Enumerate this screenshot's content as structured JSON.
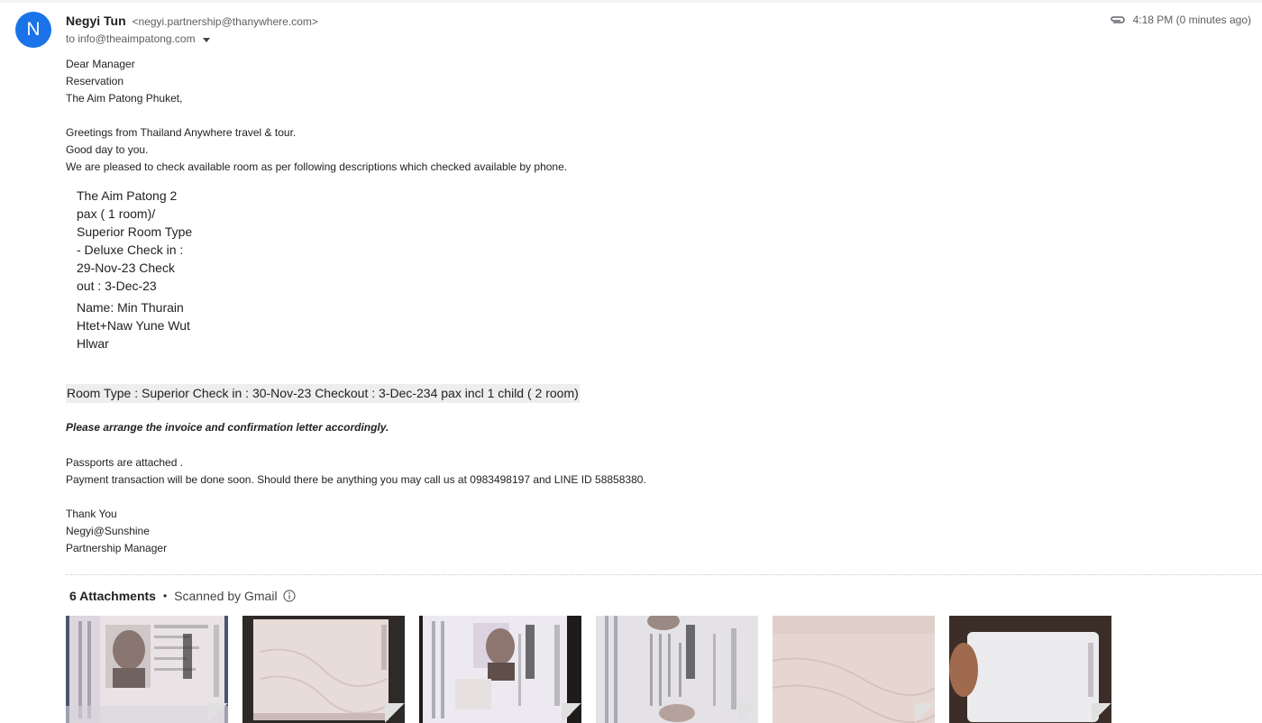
{
  "header": {
    "avatar_letter": "N",
    "sender_name": "Negyi Tun",
    "sender_email": "<negyi.partnership@thanywhere.com>",
    "recipient": "to info@theaimpatong.com",
    "time": "4:18 PM (0 minutes ago)"
  },
  "body": {
    "greeting_lines": [
      "Dear Manager",
      "Reservation",
      "The Aim Patong Phuket,"
    ],
    "intro_lines": [
      "Greetings from Thailand Anywhere travel & tour.",
      "Good day to you.",
      "We are pleased to check available room as per following descriptions which checked available by phone."
    ],
    "booking_lines": [
      "The Aim Patong 2",
      "pax ( 1 room)/",
      "Superior Room Type",
      "- Deluxe Check in :",
      "29-Nov-23 Check",
      "out : 3-Dec-23"
    ],
    "name_lines": [
      "Name: Min Thurain",
      "Htet+Naw Yune Wut",
      "Hlwar"
    ],
    "room_type_line": "Room Type : Superior Check in : 30-Nov-23 Checkout : 3-Dec-234 pax incl 1 child ( 2 room)",
    "arrange_line": "Please arrange the invoice and confirmation letter accordingly.",
    "passport_lines": [
      "Passports are attached .",
      "Payment transaction will be done soon. Should there be anything you may call us at 0983498197 and LINE ID 58858380."
    ],
    "closing_lines": [
      "Thank You",
      "Negyi@Sunshine",
      "Partnership Manager"
    ]
  },
  "attachments": {
    "count_label": "6 Attachments",
    "separator": "•",
    "scanned_label": "Scanned by Gmail",
    "thumbs": [
      {
        "kind": "passport-photo-page"
      },
      {
        "kind": "blank-page"
      },
      {
        "kind": "passport-photo-page"
      },
      {
        "kind": "passport-photo-page-rotated"
      },
      {
        "kind": "blank-page"
      },
      {
        "kind": "blank-page-hand"
      }
    ]
  },
  "colors": {
    "avatar": "#1a73e8",
    "highlight": "#eeeeee"
  },
  "icons": [
    "attachment-clip-icon",
    "chevron-down-icon",
    "info-icon"
  ]
}
